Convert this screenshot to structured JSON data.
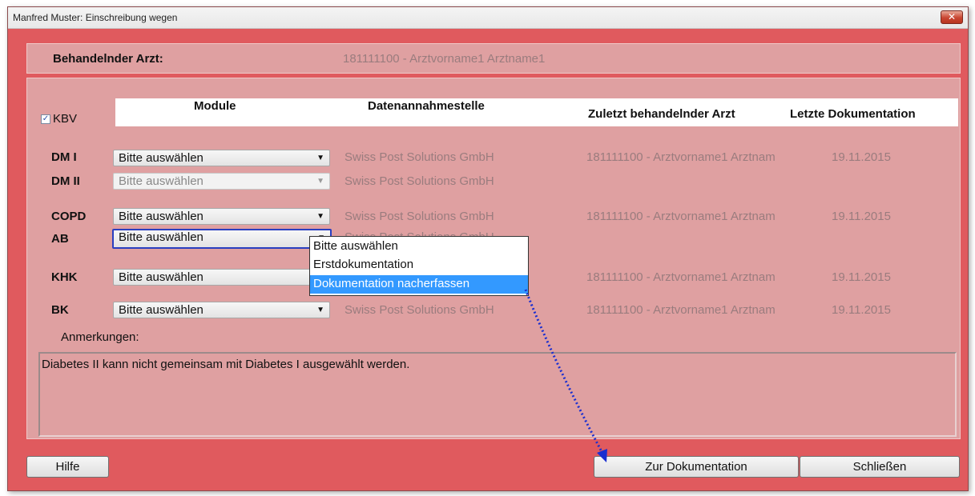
{
  "window": {
    "title": "Manfred Muster: Einschreibung wegen",
    "close_glyph": "✕"
  },
  "header": {
    "label": "Behandelnder Arzt:",
    "value": "181111100 - Arztvorname1 Arztname1"
  },
  "kbv": {
    "label": "KBV",
    "checked": true,
    "check_glyph": "✓"
  },
  "columns": {
    "module": "Module",
    "datenannahmestelle": "Datenannahmestelle",
    "zuletzt_arzt": "Zuletzt behandelnder Arzt",
    "letzte_doku": "Letzte Dokumentation"
  },
  "rows": [
    {
      "name": "DM I",
      "select": "Bitte auswählen",
      "stelle": "Swiss Post Solutions GmbH",
      "arzt": "181111100 - Arztvorname1 Arztnam",
      "datum": "19.11.2015"
    },
    {
      "name": "DM II",
      "select": "Bitte auswählen",
      "stelle": "Swiss Post Solutions GmbH",
      "arzt": "",
      "datum": ""
    },
    {
      "name": "COPD",
      "select": "Bitte auswählen",
      "stelle": "Swiss Post Solutions GmbH",
      "arzt": "181111100 - Arztvorname1 Arztnam",
      "datum": "19.11.2015"
    },
    {
      "name": "AB",
      "select": "Bitte auswählen",
      "stelle": "Swiss Post Solutions GmbH",
      "arzt": "",
      "datum": ""
    },
    {
      "name": "KHK",
      "select": "Bitte auswählen",
      "stelle": "",
      "arzt": "181111100 - Arztvorname1 Arztnam",
      "datum": "19.11.2015"
    },
    {
      "name": "BK",
      "select": "Bitte auswählen",
      "stelle": "Swiss Post Solutions GmbH",
      "arzt": "181111100 - Arztvorname1 Arztnam",
      "datum": "19.11.2015"
    }
  ],
  "dropdown": {
    "options": [
      "Bitte auswählen",
      "Erstdokumentation",
      "Dokumentation nacherfassen"
    ],
    "highlighted": "Dokumentation nacherfassen"
  },
  "anmerkungen": {
    "label": "Anmerkungen:",
    "text": "Diabetes II kann nicht gemeinsam mit Diabetes I ausgewählt werden."
  },
  "buttons": {
    "help": "Hilfe",
    "zur_doku": "Zur Dokumentation",
    "close": "Schließen"
  },
  "colors": {
    "window_bg": "#e05a5e",
    "panel_bg": "#dfa0a1",
    "highlight": "#3399ff",
    "annotation_arrow": "#1a2fd0"
  }
}
